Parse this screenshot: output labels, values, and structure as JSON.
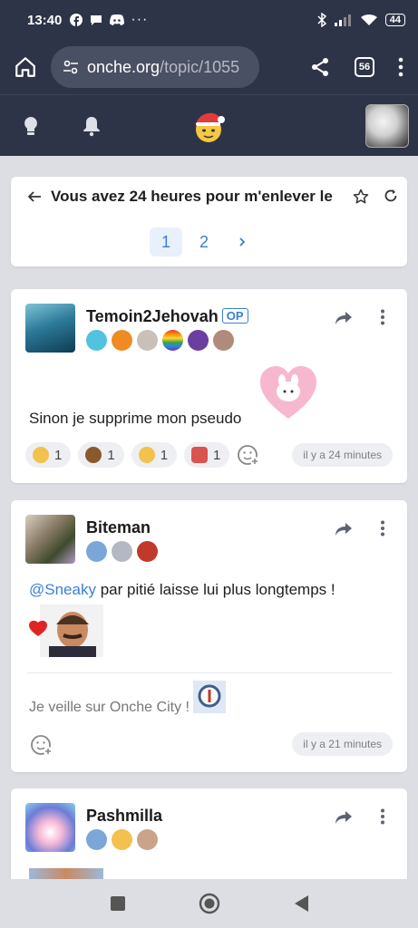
{
  "status_bar": {
    "time": "13:40",
    "battery": "44"
  },
  "browser": {
    "url_domain": "onche.org",
    "url_path": "/topic/1055",
    "tabs_count": "56"
  },
  "topic": {
    "title": "Vous avez 24 heures pour m'enlever le",
    "pages": [
      "1",
      "2"
    ],
    "current_page": "1"
  },
  "posts": [
    {
      "username": "Temoin2Jehovah",
      "op_label": "OP",
      "text": "Sinon je supprime mon pseudo",
      "reactions": [
        {
          "emoji": "hug-smiley",
          "count": "1",
          "color": "#f2c14e"
        },
        {
          "emoji": "poop",
          "count": "1",
          "color": "#8a5a2b"
        },
        {
          "emoji": "sad-smiley",
          "count": "1",
          "color": "#f2c14e"
        },
        {
          "emoji": "chicken",
          "count": "1",
          "color": "#d9534f"
        }
      ],
      "timestamp": "il y a 24 minutes"
    },
    {
      "username": "Biteman",
      "mention": "@Sneaky",
      "text": " par pitié laisse lui plus longtemps !",
      "signature": "Je veille sur Onche City !",
      "timestamp": "il y a 21 minutes"
    },
    {
      "username": "Pashmilla"
    }
  ],
  "colors": {
    "chrome": "#2e3447",
    "accent": "#3b7fd4",
    "background": "#dcdee3"
  }
}
